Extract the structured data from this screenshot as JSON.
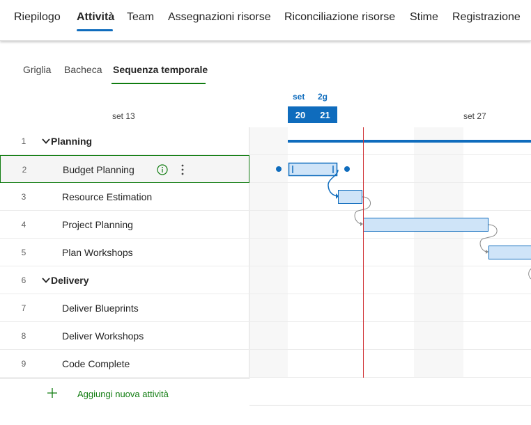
{
  "top_nav": {
    "items": [
      {
        "label": "Riepilogo",
        "active": false
      },
      {
        "label": "Attività",
        "active": true
      },
      {
        "label": "Team",
        "active": false
      },
      {
        "label": "Assegnazioni risorse",
        "active": false
      },
      {
        "label": "Riconciliazione risorse",
        "active": false
      },
      {
        "label": "Stime",
        "active": false
      },
      {
        "label": "Registrazione",
        "active": false
      }
    ]
  },
  "view_tabs": {
    "items": [
      {
        "label": "Griglia",
        "active": false
      },
      {
        "label": "Bacheca",
        "active": false
      },
      {
        "label": "Sequenza temporale",
        "active": true
      }
    ]
  },
  "timeline_header": {
    "week_label_1": "set 13",
    "week_label_2": "set 27",
    "month_label": "set",
    "duration_label": "2g",
    "day_1": "20",
    "day_2": "21"
  },
  "rows": [
    {
      "num": "1",
      "label": "Planning",
      "summary": true
    },
    {
      "num": "2",
      "label": "Budget Planning",
      "summary": false,
      "selected": true
    },
    {
      "num": "3",
      "label": "Resource Estimation",
      "summary": false
    },
    {
      "num": "4",
      "label": "Project Planning",
      "summary": false
    },
    {
      "num": "5",
      "label": "Plan Workshops",
      "summary": false
    },
    {
      "num": "6",
      "label": "Delivery",
      "summary": true
    },
    {
      "num": "7",
      "label": "Deliver Blueprints",
      "summary": false
    },
    {
      "num": "8",
      "label": "Deliver Workshops",
      "summary": false
    },
    {
      "num": "9",
      "label": "Code Complete",
      "summary": false
    }
  ],
  "add_task": {
    "label": "Aggiungi nuova attività"
  },
  "icons": {
    "expand": "chevron-down-icon",
    "info": "info-icon",
    "more": "more-vertical-icon",
    "add": "plus-icon"
  },
  "colors": {
    "accent_blue": "#0f6cbd",
    "accent_green": "#107c10",
    "bar_fill": "#cfe4f8",
    "today_line": "#d13438"
  }
}
